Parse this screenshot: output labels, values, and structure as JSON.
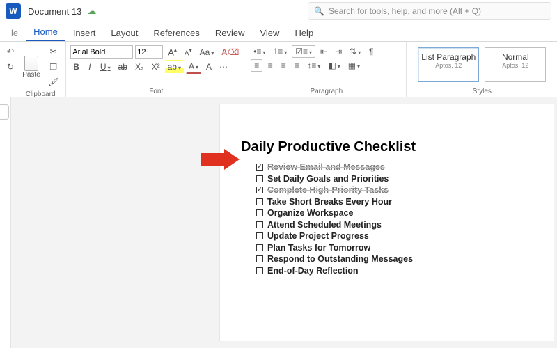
{
  "titlebar": {
    "doc_title": "Document 13"
  },
  "search": {
    "placeholder": "Search for tools, help, and more (Alt + Q)"
  },
  "tabs": {
    "le": "le",
    "home": "Home",
    "insert": "Insert",
    "layout": "Layout",
    "references": "References",
    "review": "Review",
    "view": "View",
    "help": "Help"
  },
  "clipboard": {
    "paste": "Paste",
    "label": "Clipboard"
  },
  "font": {
    "name": "Arial Bold",
    "size": "12",
    "inc": "A",
    "dec": "A",
    "case": "Aa",
    "clear": "A",
    "b": "B",
    "i": "I",
    "u": "U",
    "s": "ab",
    "sub": "X₂",
    "sup": "X²",
    "highlight": "A",
    "color": "A",
    "label": "Font"
  },
  "paragraph": {
    "label": "Paragraph"
  },
  "styles": {
    "s1_name": "List Paragraph",
    "s1_sub": "Aptos, 12",
    "s2_name": "Normal",
    "s2_sub": "Aptos, 12",
    "label": "Styles"
  },
  "document": {
    "heading": "Daily Productive Checklist",
    "items": [
      {
        "text": "Review Email and Messages",
        "done": true
      },
      {
        "text": "Set Daily Goals and Priorities",
        "done": false
      },
      {
        "text": "Complete High-Priority Tasks",
        "done": true
      },
      {
        "text": "Take Short Breaks Every Hour",
        "done": false
      },
      {
        "text": "Organize Workspace",
        "done": false
      },
      {
        "text": " Attend Scheduled Meetings",
        "done": false
      },
      {
        "text": "Update Project Progress",
        "done": false
      },
      {
        "text": " Plan Tasks for Tomorrow",
        "done": false
      },
      {
        "text": "Respond to Outstanding Messages",
        "done": false
      },
      {
        "text": "End-of-Day Reflection",
        "done": false
      }
    ]
  }
}
